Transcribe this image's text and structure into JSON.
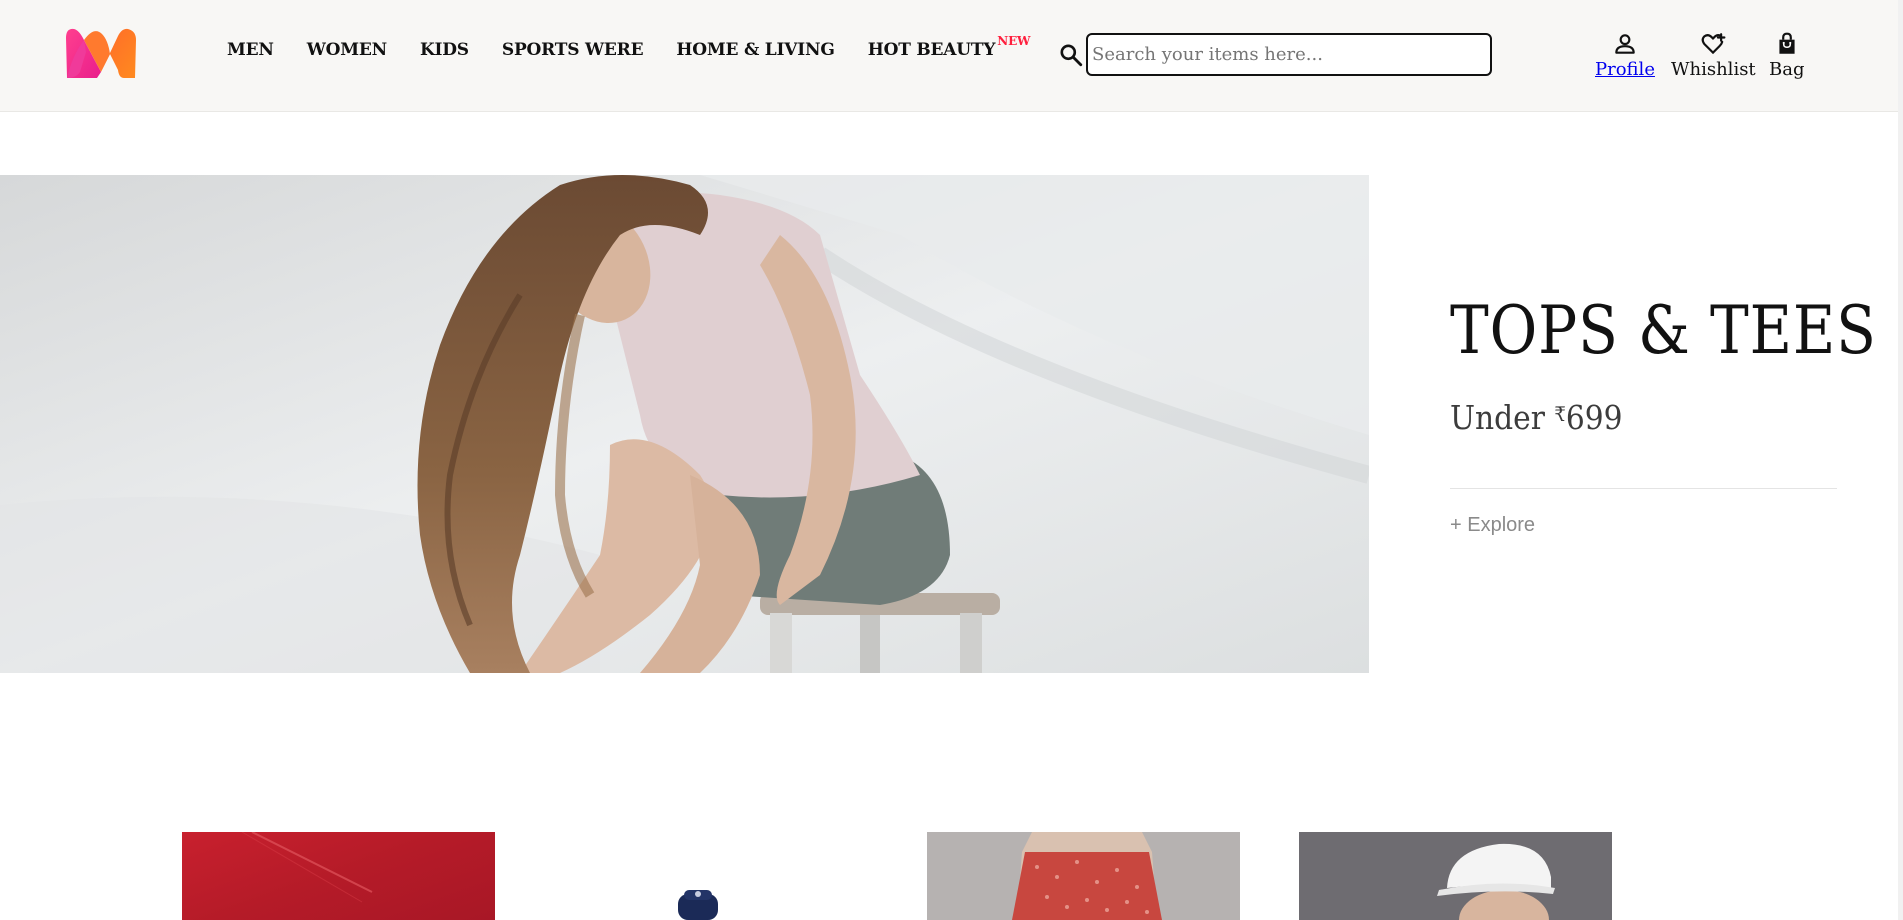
{
  "header": {
    "logo_alt": "Myntra",
    "nav": [
      {
        "label": "MEN"
      },
      {
        "label": "WOMEN"
      },
      {
        "label": "KIDS"
      },
      {
        "label": "SPORTS WERE"
      },
      {
        "label": "HOME & LIVING"
      },
      {
        "label": "HOT BEAUTY",
        "badge": "NEW"
      }
    ],
    "search": {
      "placeholder": "Search your items here...",
      "icon": "search-icon"
    },
    "actions": {
      "profile": {
        "label": "Profile",
        "icon": "user-icon"
      },
      "wishlist": {
        "label": "Whishlist",
        "icon": "heart-plus-icon"
      },
      "bag": {
        "label": "Bag",
        "icon": "shopping-bag-icon"
      }
    }
  },
  "hero": {
    "title": "TOPS & TEES",
    "subtitle_prefix": "Under ",
    "currency": "₹",
    "price": "699",
    "cta": "+ Explore"
  },
  "colors": {
    "header_bg": "#f8f7f5",
    "logo_pink": "#ff3f8e",
    "logo_orange": "#ff8a1f",
    "badge_new": "#ff1f3d",
    "link_blue": "#0000ee"
  }
}
